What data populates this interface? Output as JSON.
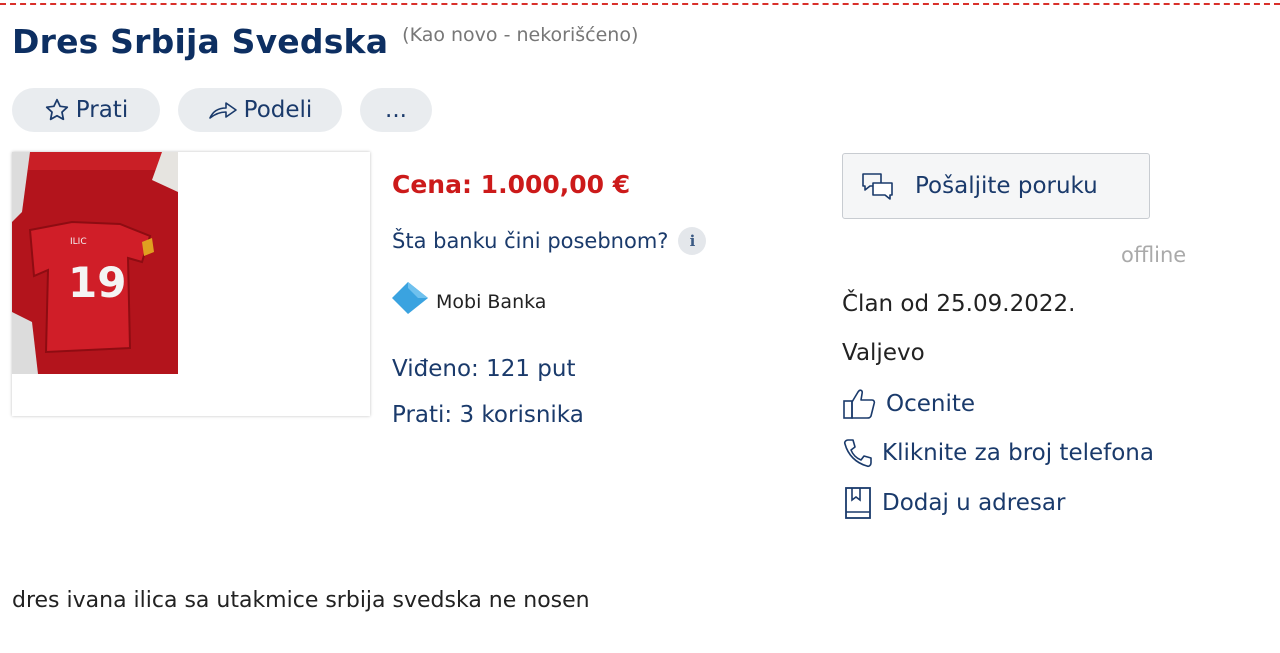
{
  "listing": {
    "title": "Dres Srbija Svedska",
    "condition": "(Kao novo - nekorišćeno)",
    "description": "dres ivana ilica sa utakmice srbija svedska ne nosen"
  },
  "actions": {
    "follow_label": "Prati",
    "share_label": "Podeli",
    "more_label": "..."
  },
  "photo": {
    "jersey_name": "ILIC",
    "jersey_number": "19"
  },
  "details": {
    "price": "Cena: 1.000,00 €",
    "bank_question": "Šta banku čini posebnom?",
    "info_glyph": "i",
    "bank_name": "Mobi Banka",
    "seen": "Viđeno: 121 put",
    "followers": "Prati: 3 korisnika"
  },
  "seller": {
    "message_button": "Pošaljite poruku",
    "status": "offline",
    "member_since": "Član od 25.09.2022.",
    "city": "Valjevo",
    "rate_label": "Ocenite",
    "phone_label": "Kliknite za broj telefona",
    "addressbook_label": "Dodaj u adresar"
  },
  "colors": {
    "title": "#0d2f62",
    "price": "#cc1a1a",
    "link": "#1a3a6b",
    "dashed_border": "#d9302b",
    "bank_logo": "#3aa3e0"
  },
  "icons": {
    "follow": "star-icon",
    "share": "share-arrow-icon",
    "message": "chat-bubbles-icon",
    "rate": "thumbs-up-icon",
    "phone": "phone-icon",
    "addressbook": "bookmark-icon",
    "info": "info-icon"
  }
}
